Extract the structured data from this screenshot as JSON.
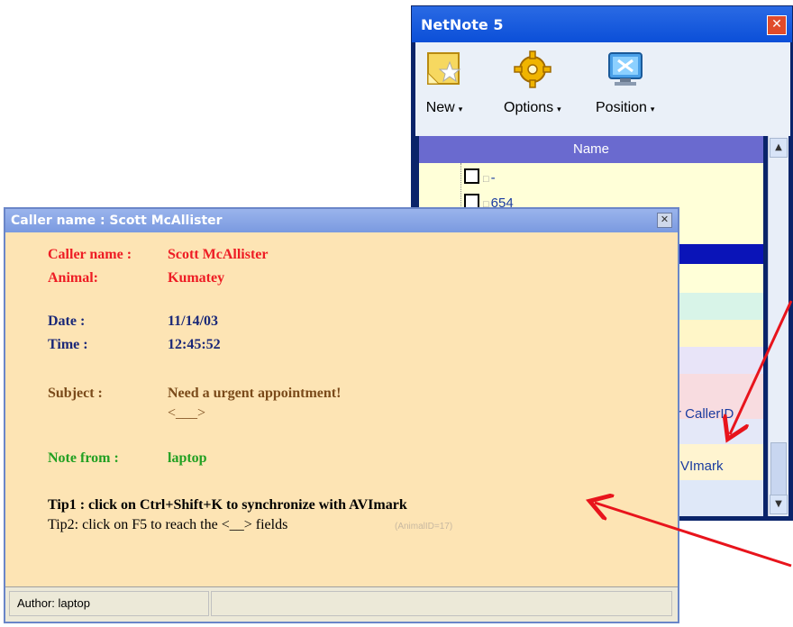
{
  "netnote": {
    "title": "NetNote 5",
    "toolbar": {
      "new_label": "New",
      "options_label": "Options",
      "position_label": "Position",
      "dropdown_glyph": "▾"
    },
    "column_header": "Name",
    "tree_items": [
      {
        "label": "-"
      },
      {
        "label": "654"
      }
    ],
    "partial_labels": {
      "caller_id": "r CallerID",
      "avimark": "VImark"
    },
    "icons": {
      "close": "✕",
      "scroll_up": "▲",
      "scroll_down": "▼",
      "lock": "🔒"
    }
  },
  "caller_popup": {
    "title": "Caller name : Scott McAllister",
    "close_glyph": "✕",
    "fields": {
      "caller_label": "Caller name :",
      "caller_value": "Scott McAllister",
      "animal_label": "Animal:",
      "animal_value": "Kumatey",
      "date_label": "Date :",
      "date_value": "11/14/03",
      "time_label": "Time :",
      "time_value": "12:45:52",
      "subject_label": "Subject :",
      "subject_value": "Need a urgent appointment!",
      "subject_placeholder": "<___>",
      "note_from_label": "Note from :",
      "note_from_value": "laptop"
    },
    "tip1": "Tip1 : click on Ctrl+Shift+K to synchronize with AVImark",
    "tip2": "Tip2: click on F5 to reach the <__> fields",
    "animal_id": "(AnimalID=17)",
    "status": {
      "author": "Author: laptop",
      "second": ""
    }
  },
  "colors": {
    "annotation_arrow": "#e8141c",
    "popup_background": "#fde4b4",
    "caller_red": "#ee1c24",
    "navy": "#1a2878",
    "brown": "#7a4a1a",
    "green": "#22a022"
  }
}
